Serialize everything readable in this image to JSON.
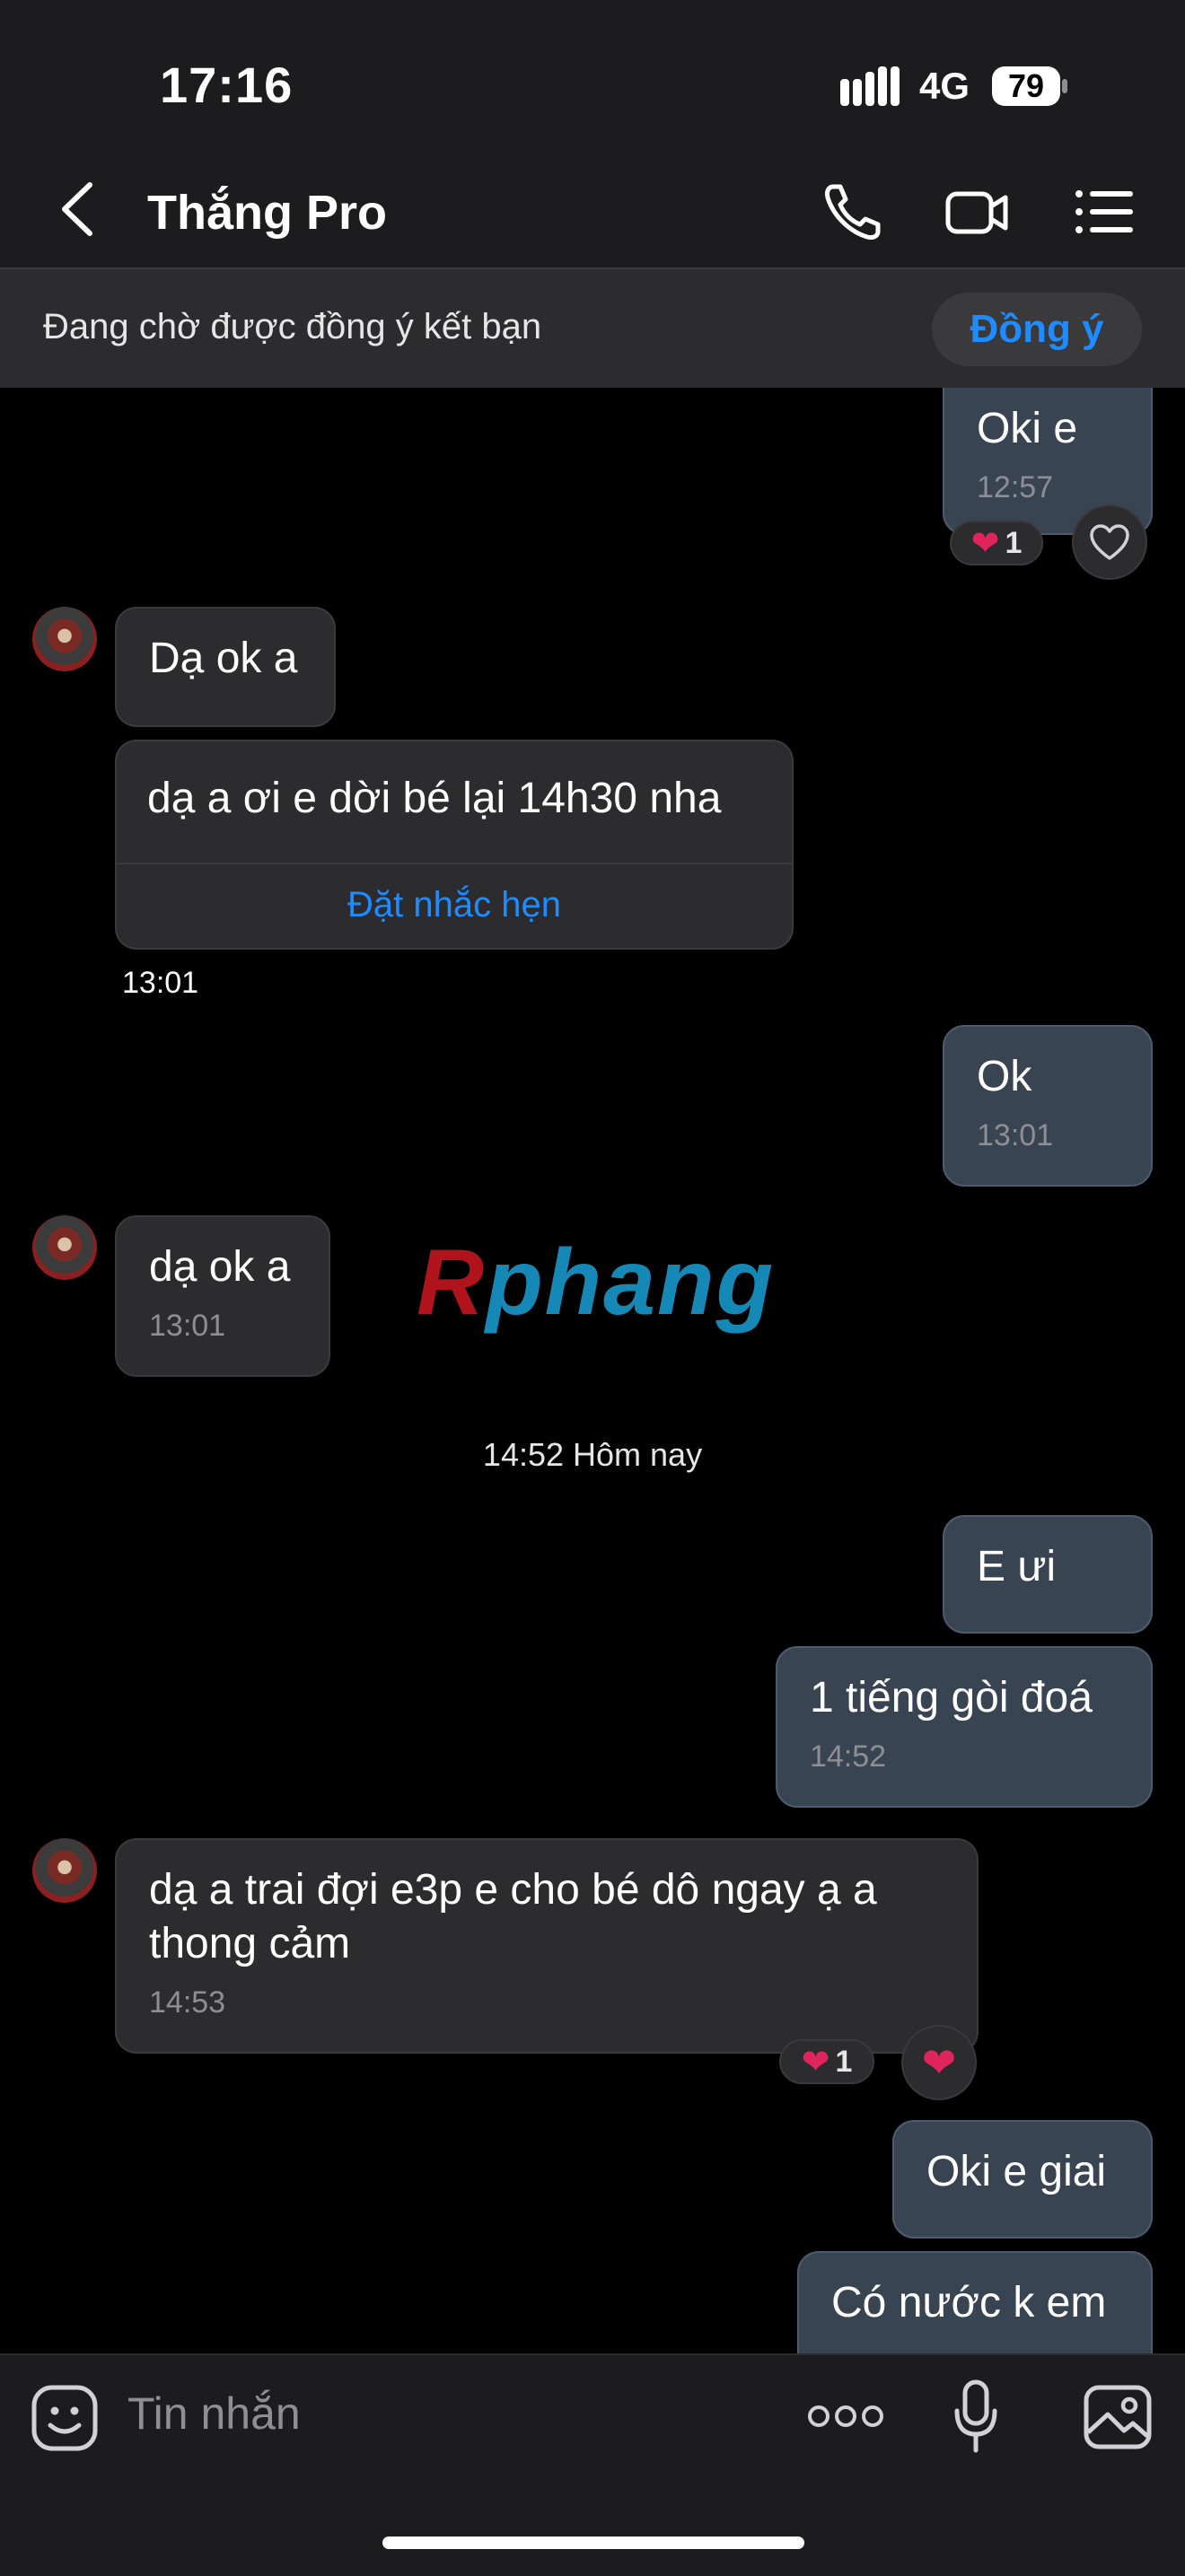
{
  "status_bar": {
    "time": "17:16",
    "network": "4G",
    "battery": "79"
  },
  "header": {
    "title": "Thắng Pro"
  },
  "banner": {
    "text": "Đang chờ được đồng ý kết bạn",
    "button": "Đồng ý"
  },
  "messages": [
    {
      "side": "out",
      "text": "Oki e",
      "time": "12:57",
      "reaction_count": "1"
    },
    {
      "side": "in",
      "text": "Dạ ok a"
    },
    {
      "side": "in",
      "text": "dạ a ơi e dời bé lại 14h30 nha",
      "action": "Đặt nhắc hẹn",
      "time": "13:01"
    },
    {
      "side": "out",
      "text": "Ok",
      "time": "13:01"
    },
    {
      "side": "in",
      "text": "dạ ok a",
      "time": "13:01"
    },
    {
      "side": "out",
      "text": "E ưi"
    },
    {
      "side": "out",
      "text": "1 tiếng gòi đoá",
      "time": "14:52"
    },
    {
      "side": "in",
      "text": "dạ a trai đợi e3p e cho bé dô ngay ạ a thong cảm",
      "time": "14:53",
      "reaction_count": "1"
    },
    {
      "side": "out",
      "text": "Oki e giai"
    },
    {
      "side": "out",
      "text": "Có nước k em"
    }
  ],
  "date_separator": "14:52 Hôm nay",
  "watermark": {
    "first": "R",
    "rest": "phang"
  },
  "composer": {
    "placeholder": "Tin nhắn"
  },
  "colors": {
    "accent": "#1e8cff",
    "outgoing_bubble": "#394453",
    "incoming_bubble": "#2c2c2e",
    "reaction": "#e0245e"
  }
}
